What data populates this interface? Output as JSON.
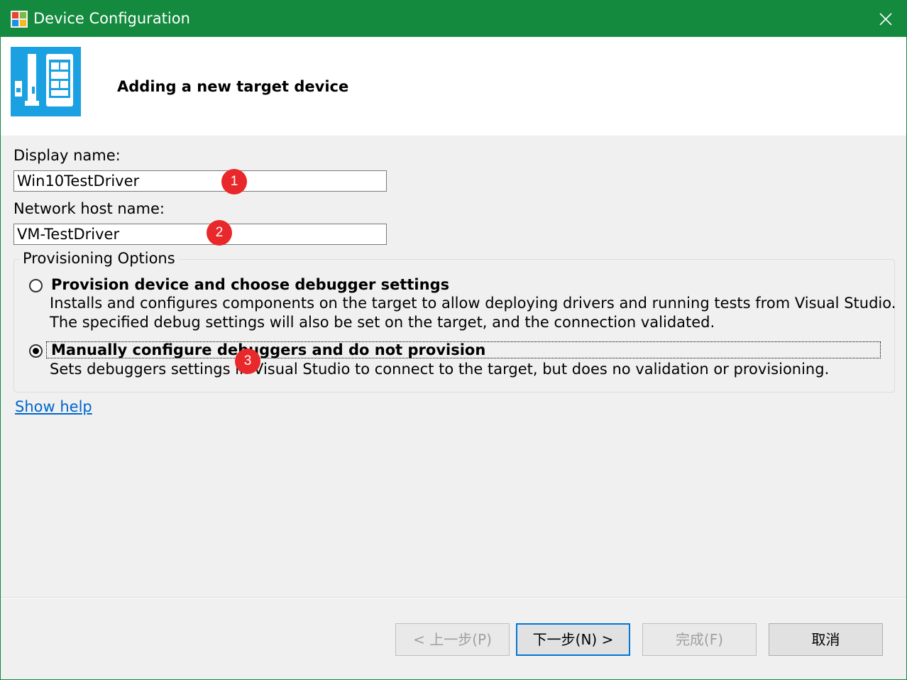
{
  "window": {
    "title": "Device Configuration",
    "colors": {
      "titlebar": "#138a3e",
      "header_bg": "#ffffff",
      "body_bg": "#f0f0f0",
      "accent": "#0078d7",
      "badge": "#e8282a",
      "link": "#0066cc"
    }
  },
  "header": {
    "title": "Adding a new target device",
    "logo_icon": "device-config-logo-icon"
  },
  "form": {
    "display_name_label": "Display name:",
    "display_name_value": "Win10TestDriver",
    "host_name_label": "Network host name:",
    "host_name_value": "VM-TestDriver"
  },
  "provisioning": {
    "caption": "Provisioning Options",
    "options": [
      {
        "title": "Provision device and choose debugger settings",
        "desc_line1": "Installs and configures components on the target to allow deploying drivers and running tests from Visual Studio.",
        "desc_line2": "The specified debug settings will also be set on the target, and the connection validated.",
        "selected": false
      },
      {
        "title": "Manually configure debuggers and do not provision",
        "desc_line1": "Sets debuggers settings in Visual Studio to connect to the target, but does no validation or provisioning.",
        "selected": true
      }
    ]
  },
  "help_link": "Show help",
  "annotations": [
    "1",
    "2",
    "3"
  ],
  "buttons": {
    "back": "< 上一步(P)",
    "next": "下一步(N) >",
    "finish": "完成(F)",
    "cancel": "取消"
  }
}
